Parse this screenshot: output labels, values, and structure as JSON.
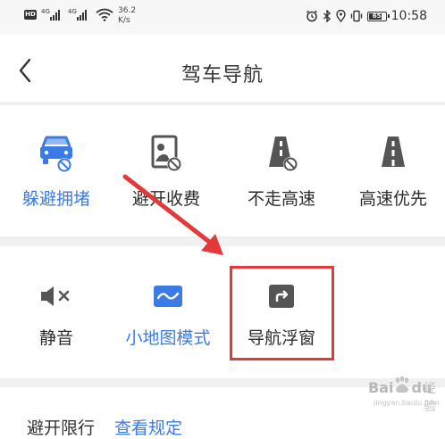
{
  "status_bar": {
    "hd_badge": "HD",
    "network_tag_1": "4G",
    "network_tag_2": "4G",
    "speed_value": "36.2",
    "speed_unit": "K/s",
    "battery_level": "65",
    "time": "10:58"
  },
  "header": {
    "title": "驾车导航"
  },
  "route_options": [
    {
      "label": "躲避拥堵",
      "icon": "car-traffic-icon",
      "active": true
    },
    {
      "label": "避开收费",
      "icon": "toll-avoid-icon",
      "active": false
    },
    {
      "label": "不走高速",
      "icon": "highway-avoid-icon",
      "active": false
    },
    {
      "label": "高速优先",
      "icon": "highway-icon",
      "active": false
    }
  ],
  "display_options": [
    {
      "label": "静音",
      "icon": "mute-icon",
      "active": false
    },
    {
      "label": "小地图模式",
      "icon": "mini-map-icon",
      "active": true
    },
    {
      "label": "导航浮窗",
      "icon": "floating-window-icon",
      "active": false
    }
  ],
  "bottom_row": {
    "label": "避开限行",
    "link": "查看规定"
  },
  "watermark": {
    "brand": "Bai",
    "brand_suffix": "du",
    "suffix_cn": "经验",
    "url": "jingyan.baidu.com"
  },
  "colors": {
    "accent": "#3b7be6",
    "annotation_red": "#e23a3a",
    "icon_gray": "#555555",
    "divider": "#f0f0f2"
  }
}
